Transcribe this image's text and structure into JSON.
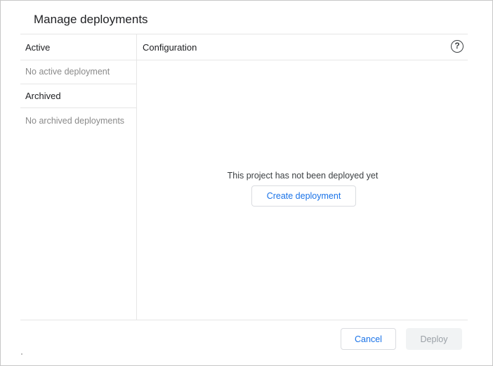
{
  "dialog": {
    "title": "Manage deployments"
  },
  "sidebar": {
    "active": {
      "header": "Active",
      "empty_text": "No active deployment"
    },
    "archived": {
      "header": "Archived",
      "empty_text": "No archived deployments"
    }
  },
  "configuration": {
    "header": "Configuration",
    "help_icon": "help-circle-icon",
    "help_glyph": "?",
    "empty_message": "This project has not been deployed yet",
    "create_label": "Create deployment"
  },
  "footer": {
    "cancel_label": "Cancel",
    "deploy_label": "Deploy",
    "deploy_enabled": false
  },
  "colors": {
    "accent": "#1a73e8",
    "disabled_bg": "#f1f3f4",
    "disabled_text": "#9aa0a6",
    "divider": "#e6e6e6"
  }
}
